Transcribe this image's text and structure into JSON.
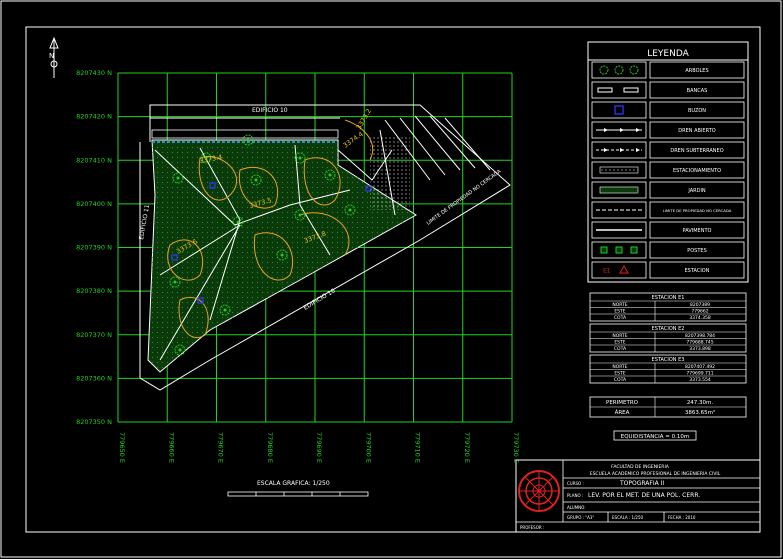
{
  "north_label": "N",
  "grid": {
    "y_labels": [
      "8207430 N",
      "8207420 N",
      "8207410 N",
      "8207400 N",
      "8207390 N",
      "8207380 N",
      "8207370 N",
      "8207360 N",
      "8207350 N"
    ],
    "x_labels": [
      "779650 E",
      "779660 E",
      "779670 E",
      "779680 E",
      "779690 E",
      "779700 E",
      "779710 E",
      "779720 E",
      "779730 E"
    ]
  },
  "plan": {
    "edificio_top": "EDIFICIO 10",
    "edificio_left": "EDIFICIO 11",
    "edificio_diag": "EDIFICIO 10",
    "limite": "LIMITE DE PROPIEDAD NO CERCADA",
    "contours": [
      "3373.4",
      "3373.5",
      "3373.8",
      "3373.6",
      "3374.4",
      "3373.2"
    ]
  },
  "scale_label": "ESCALA GRAFICA:   1/250",
  "legend": {
    "title": "LEYENDA",
    "items": [
      {
        "label": "ARBOLES",
        "symbol": "trees"
      },
      {
        "label": "BANCAS",
        "symbol": "benches"
      },
      {
        "label": "BUZON",
        "symbol": "buzon"
      },
      {
        "label": "DREN ABIERTO",
        "symbol": "dren-abierto"
      },
      {
        "label": "DREN SUBTERRANEO",
        "symbol": "dren-subterraneo"
      },
      {
        "label": "ESTACIONAMIENTO",
        "symbol": "estacionamiento"
      },
      {
        "label": "JARDIN",
        "symbol": "jardin"
      },
      {
        "label": "LIMITE DE PROPIEDAD NO CERCADA",
        "symbol": "limite"
      },
      {
        "label": "PAVIMENTO",
        "symbol": "pavimento"
      },
      {
        "label": "POSTES",
        "symbol": "postes"
      },
      {
        "label": "ESTACION",
        "symbol": "estacion"
      }
    ]
  },
  "stations": [
    {
      "title": "ESTACION E1",
      "rows": [
        [
          "NORTE",
          "8207389"
        ],
        [
          "ESTE",
          "779662"
        ],
        [
          "COTA",
          "3374.358"
        ]
      ]
    },
    {
      "title": "ESTACION E2",
      "rows": [
        [
          "NORTE",
          "8207398.784"
        ],
        [
          "ESTE",
          "779688.745"
        ],
        [
          "COTA",
          "3373.898"
        ]
      ]
    },
    {
      "title": "ESTACION E3",
      "rows": [
        [
          "NORTE",
          "8207407.492"
        ],
        [
          "ESTE",
          "779699.711"
        ],
        [
          "COTA",
          "3373.554"
        ]
      ]
    }
  ],
  "summary": [
    [
      "PERIMETRO",
      "247.30m."
    ],
    [
      "ÁREA",
      "3863.65m²"
    ]
  ],
  "equidistancia": "EQUIDISTANCIA = 0.10m",
  "title_block": {
    "faculty": "FACULTAD DE INGENIERIA",
    "school": "ESCUELA ACADEMICO PROFESIONAL DE INGENIERIA CIVIL",
    "curso_label": "CURSO :",
    "curso": "TOPOGRAFIA II",
    "plano_label": "PLANO :",
    "plano": "LEV. POR EL MET. DE UNA POL. CERR.",
    "alumno_label": "ALUMNO:",
    "grupo": "GRUPO :  \"A3\"",
    "escala": "ESCALA :  1/250",
    "fecha": "FECHA : 2010",
    "profesor_label": "PROFESOR :"
  }
}
